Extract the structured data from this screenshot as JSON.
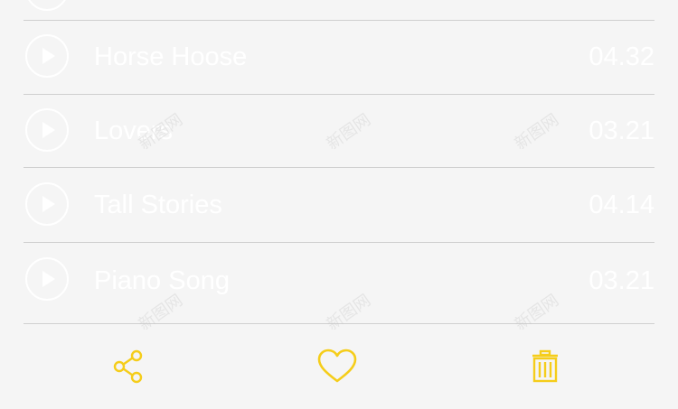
{
  "tracks": [
    {
      "title": "",
      "duration": ""
    },
    {
      "title": "Horse Hoose",
      "duration": "04.32"
    },
    {
      "title": "Lovers",
      "duration": "03.21"
    },
    {
      "title": "Tall Stories",
      "duration": "04.14"
    },
    {
      "title": "Piano Song",
      "duration": "03.21"
    }
  ],
  "toolbar": {
    "share_icon": "share-icon",
    "like_icon": "heart-icon",
    "delete_icon": "trash-icon",
    "accent_color": "#f5cd1a"
  },
  "watermark_text": "新图网"
}
